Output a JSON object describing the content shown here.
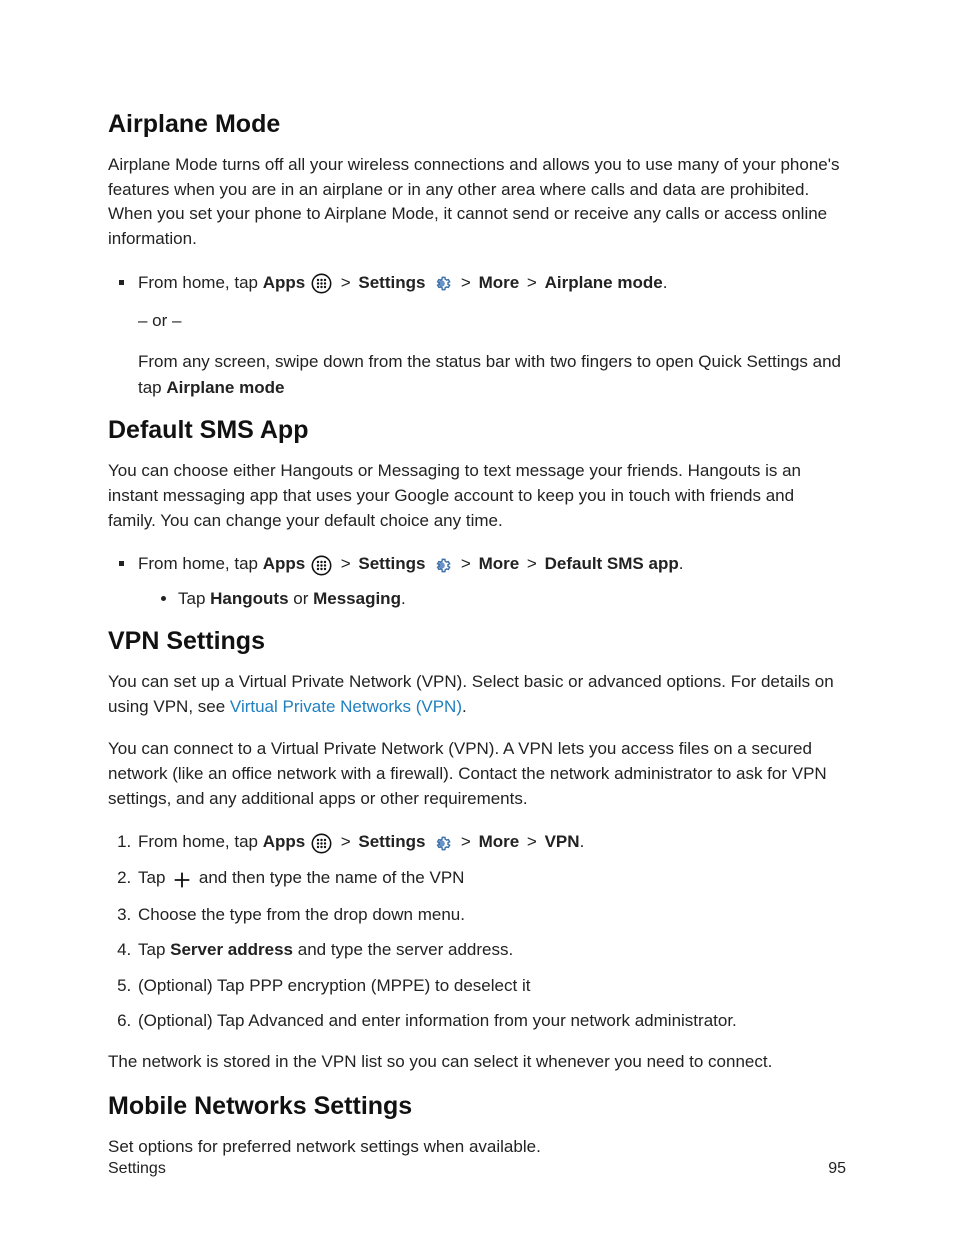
{
  "sections": {
    "airplane": {
      "heading": "Airplane Mode",
      "para1": "Airplane Mode turns off all your wireless connections and allows you to use many of your phone's features when you are in an airplane or in any other area where calls and data are prohibited. When you set your phone to Airplane Mode, it cannot send or receive any calls or access online information.",
      "step_fromhome": "From home, tap ",
      "apps_label": "Apps",
      "settings_label": "Settings",
      "more_label": "More",
      "target_label": "Airplane mode",
      "or_label": "– or –",
      "swipe_a": "From any screen, swipe down from the status bar with two fingers to open Quick Settings and tap ",
      "swipe_b": "Airplane mode"
    },
    "sms": {
      "heading": "Default SMS App",
      "para1": "You can choose either Hangouts or Messaging to text message your friends. Hangouts is an instant messaging app that uses your Google account to keep you in touch with friends and family. You can change your default choice any time.",
      "target_label": "Default SMS app",
      "tap_prefix": "Tap ",
      "hangouts": "Hangouts",
      "or_word": " or ",
      "messaging": "Messaging",
      "period": "."
    },
    "vpn": {
      "heading": "VPN Settings",
      "para1_a": "You can set up a Virtual Private Network (VPN). Select basic or advanced options. For details on using VPN, see ",
      "para1_link": "Virtual Private Networks (VPN)",
      "para1_c": ".",
      "para2": "You can connect to a Virtual Private Network (VPN). A VPN lets you access files on a secured network (like an office network with a firewall). Contact the network administrator to ask for VPN settings, and any additional apps or other requirements.",
      "target_label": "VPN",
      "step2_a": "Tap ",
      "step2_b": " and then type the name of the VPN",
      "step3": "Choose the type from the drop down menu.",
      "step4_a": "Tap ",
      "step4_b": "Server address",
      "step4_c": " and type the server address.",
      "step5": "(Optional) Tap PPP encryption (MPPE) to deselect it",
      "step6": "(Optional) Tap Advanced and enter information from your network administrator.",
      "para3": "The network is stored in the VPN list so you can select it whenever you need to connect."
    },
    "mobile": {
      "heading": "Mobile Networks Settings",
      "para1": "Set options for preferred network settings when available."
    }
  },
  "common": {
    "gt": ">",
    "period": "."
  },
  "footer": {
    "left": "Settings",
    "right": "95"
  }
}
